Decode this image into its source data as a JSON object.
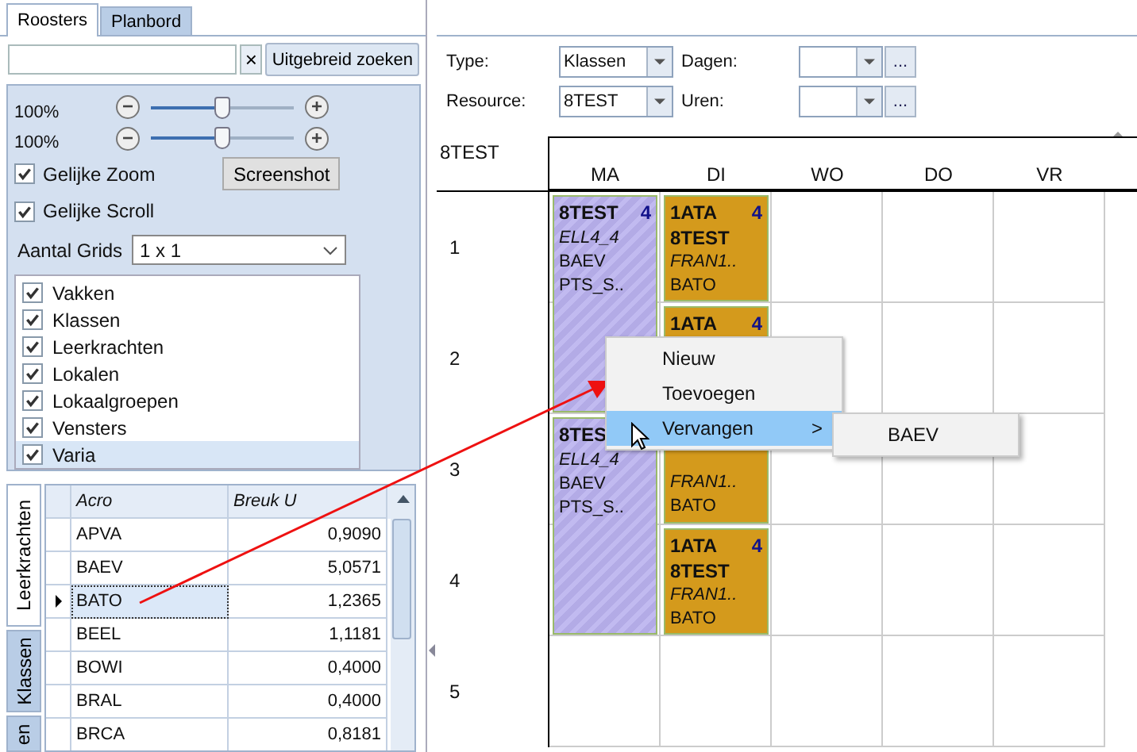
{
  "tabs": [
    {
      "label": "Roosters",
      "selected": true
    },
    {
      "label": "Planbord",
      "selected": false
    }
  ],
  "search": {
    "clear": "×",
    "advanced_button": "Uitgebreid zoeken"
  },
  "zoom": [
    {
      "reading": "100%",
      "level": 0.5,
      "minus": "−",
      "plus": "+"
    },
    {
      "reading": "100%",
      "level": 0.5,
      "minus": "−",
      "plus": "+"
    }
  ],
  "options": [
    {
      "label": "Gelijke Zoom",
      "checked": true
    },
    {
      "label": "Gelijke Scroll",
      "checked": true
    }
  ],
  "screenshot_button": "Screenshot",
  "grids": {
    "label": "Aantal Grids",
    "value": "1 x 1"
  },
  "layers": [
    {
      "label": "Vakken",
      "checked": true,
      "selected": false
    },
    {
      "label": "Klassen",
      "checked": true,
      "selected": false
    },
    {
      "label": "Leerkrachten",
      "checked": true,
      "selected": false
    },
    {
      "label": "Lokalen",
      "checked": true,
      "selected": false
    },
    {
      "label": "Lokaalgroepen",
      "checked": true,
      "selected": false
    },
    {
      "label": "Vensters",
      "checked": true,
      "selected": false
    },
    {
      "label": "Varia",
      "checked": true,
      "selected": true
    }
  ],
  "side_tabs": [
    {
      "label": "Leerkrachten",
      "selected": true
    },
    {
      "label": "Klassen",
      "selected": false
    },
    {
      "label": "en",
      "selected": false
    }
  ],
  "table": {
    "columns": [
      "Acro",
      "Breuk U"
    ],
    "rows": [
      {
        "acro": "APVA",
        "breuk": "0,9090",
        "selected": false
      },
      {
        "acro": "BAEV",
        "breuk": "5,0571",
        "selected": false
      },
      {
        "acro": "BATO",
        "breuk": "1,2365",
        "selected": true
      },
      {
        "acro": "BEEL",
        "breuk": "1,1181",
        "selected": false
      },
      {
        "acro": "BOWI",
        "breuk": "0,4000",
        "selected": false
      },
      {
        "acro": "BRAL",
        "breuk": "0,4000",
        "selected": false
      },
      {
        "acro": "BRCA",
        "breuk": "0,8181",
        "selected": false
      }
    ]
  },
  "filters": [
    {
      "label": "Type:",
      "value": "Klassen",
      "label2": "Dagen:",
      "more": "..."
    },
    {
      "label": "Resource:",
      "value": "8TEST",
      "label2": "Uren:",
      "more": "..."
    }
  ],
  "timetable": {
    "title": "8TEST",
    "periods": [
      "1",
      "2",
      "3",
      "4",
      "5"
    ],
    "days": [
      {
        "label": "MA",
        "lessons": [
          {
            "kind": "double",
            "title": "8TEST",
            "count": "4",
            "lines": [
              {
                "text": "ELL4_4",
                "kind": "italic"
              },
              {
                "text": "BAEV",
                "kind": "plain"
              },
              {
                "text": "PTS_S..",
                "kind": "plain"
              }
            ]
          },
          {
            "kind": "double",
            "title": "8TES",
            "lines": [
              {
                "text": "ELL4_4",
                "kind": "italic"
              },
              {
                "text": "BAEV",
                "kind": "plain"
              },
              {
                "text": "PTS_S..",
                "kind": "plain"
              }
            ]
          }
        ]
      },
      {
        "label": "DI",
        "lessons": [
          {
            "kind": "single",
            "title": "1ATA",
            "count": "4",
            "lines": [
              {
                "text": "8TEST",
                "kind": "bold"
              },
              {
                "text": "FRAN1..",
                "kind": "italic"
              },
              {
                "text": "BATO",
                "kind": "plain"
              }
            ]
          },
          {
            "kind": "single",
            "title": "1ATA",
            "count": "4"
          },
          {
            "kind": "single",
            "lines": [
              {
                "text": "FRAN1..",
                "kind": "italic"
              },
              {
                "text": "BATO",
                "kind": "plain"
              }
            ]
          },
          {
            "kind": "single",
            "title": "1ATA",
            "count": "4",
            "lines": [
              {
                "text": "8TEST",
                "kind": "bold"
              },
              {
                "text": "FRAN1..",
                "kind": "italic"
              },
              {
                "text": "BATO",
                "kind": "plain"
              }
            ]
          }
        ]
      },
      {
        "label": "WO"
      },
      {
        "label": "DO"
      },
      {
        "label": "VR"
      }
    ]
  },
  "context_menu": {
    "items": [
      {
        "label": "Nieuw",
        "selected": false,
        "submenu": false
      },
      {
        "label": "Toevoegen",
        "selected": false,
        "submenu": false
      },
      {
        "label": "Vervangen",
        "selected": true,
        "submenu": true
      }
    ],
    "submenu_arrow": ">",
    "submenu_items": [
      "BAEV"
    ]
  }
}
